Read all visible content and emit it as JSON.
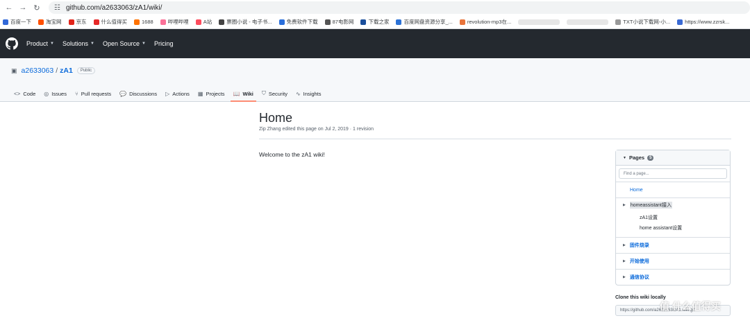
{
  "browser": {
    "url": "github.com/a2633063/zA1/wiki/",
    "bookmarks": [
      {
        "label": "百度一下",
        "color": "#3168d8"
      },
      {
        "label": "淘宝网",
        "color": "#ff5000"
      },
      {
        "label": "京东",
        "color": "#e1251b"
      },
      {
        "label": "什么值得买",
        "color": "#e62828"
      },
      {
        "label": "1688",
        "color": "#ff7300"
      },
      {
        "label": "哔哩哔哩",
        "color": "#fb7299"
      },
      {
        "label": "A站",
        "color": "#fd4c5d"
      },
      {
        "label": "票圈小说 - 电子书...",
        "color": "#444444"
      },
      {
        "label": "免费软件下载",
        "color": "#2a6fdb"
      },
      {
        "label": "87电影网",
        "color": "#555555"
      },
      {
        "label": "下载之家",
        "color": "#1a4f9c"
      },
      {
        "label": "百度网盘资源分享_...",
        "color": "#2c72d6"
      },
      {
        "label": "revolution-mp3在...",
        "color": "#e8743b"
      },
      {
        "label": "TXT小说下载网-小...",
        "color": "#999999"
      },
      {
        "label": "https://www.zzrsk...",
        "color": "#3a6ad4"
      }
    ]
  },
  "header": {
    "nav": [
      "Product",
      "Solutions",
      "Open Source",
      "Pricing"
    ]
  },
  "repo": {
    "owner": "a2633063",
    "sep": "/",
    "name": "zA1",
    "visibility": "Public",
    "tabs": [
      {
        "label": "Code",
        "icon": "<>"
      },
      {
        "label": "Issues",
        "icon": "◎"
      },
      {
        "label": "Pull requests",
        "icon": "⑂"
      },
      {
        "label": "Discussions",
        "icon": "💬"
      },
      {
        "label": "Actions",
        "icon": "▷"
      },
      {
        "label": "Projects",
        "icon": "▦"
      },
      {
        "label": "Wiki",
        "icon": "📖"
      },
      {
        "label": "Security",
        "icon": "⛉"
      },
      {
        "label": "Insights",
        "icon": "∿"
      }
    ]
  },
  "wiki": {
    "title": "Home",
    "meta": "Zip Zhang edited this page on Jul 2, 2019 · 1 revision",
    "body": "Welcome to the zA1 wiki!"
  },
  "sidebar": {
    "pages_label": "Pages",
    "pages_count": "5",
    "find_placeholder": "Find a page...",
    "home": "Home",
    "group1": "homeassistant接入",
    "sub1": "zA1设置",
    "sub2": "home assistant设置",
    "group2": "固件烧录",
    "group3": "开始使用",
    "group4": "通信协议",
    "clone_label": "Clone this wiki locally",
    "clone_url": "https://github.com/a2633063/zA1.wiki.git"
  },
  "watermark": "值 什么值得买"
}
